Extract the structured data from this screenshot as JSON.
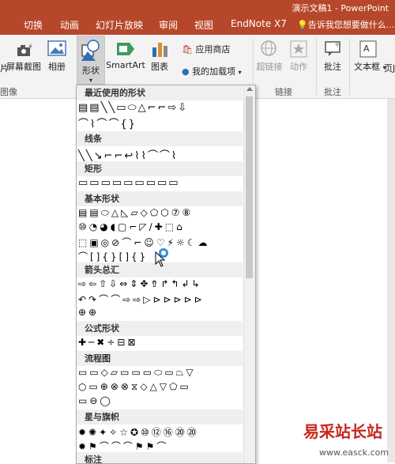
{
  "window": {
    "title": "演示文稿1 - PowerPoint"
  },
  "tabs": [
    "切换",
    "动画",
    "幻灯片放映",
    "审阅",
    "视图",
    "EndNote X7"
  ],
  "tell_me": "告诉我您想要做什么...",
  "ribbon": {
    "left_partial": "片",
    "screenshot": "屏幕截图",
    "album": "相册",
    "shapes": "形状",
    "smartart": "SmartArt",
    "chart": "图表",
    "app_store": "应用商店",
    "my_addins": "我的加载项",
    "hyperlink": "超链接",
    "action": "动作",
    "comment": "批注",
    "textbox": "文本框",
    "header_partial": "页J",
    "group_images": "图像",
    "group_links": "链接",
    "group_comments": "批注"
  },
  "shapes_panel": {
    "categories": {
      "recent": "最近使用的形状",
      "lines": "线条",
      "rect": "矩形",
      "basic": "基本形状",
      "arrows": "箭头总汇",
      "equation": "公式形状",
      "flowchart": "流程图",
      "stars": "星与旗帜",
      "callouts": "标注"
    },
    "rows": {
      "recent1": "▤▤╲╲▭⬭△⌐⌐⇨⇩",
      "recent2": "⌒⌇⌒⌒{}",
      "lines1": "╲╲↘⌐⌐↩⌇⌇⌒⌒⌇",
      "rect1": "▭▭▭▭▭▭▭▭▭",
      "basic1": "▤▤⬭△◺▱◇⬠⬡⑦⑧",
      "basic2": "⑩◔◕◖▢⌐◸∕✚⬚⌂",
      "basic3": "⬚▣◎⊘⌒⌐☺♡⚡☼☾☁",
      "basic4": "⌒[]{}[]{}",
      "arrows1": "⇨⇦⇧⇩⇔⇕✥⇮↱↰↲↳",
      "arrows2": "↶↷⌒⌒⇨⇨▷⊳⊳⊳⊳⊳",
      "arrows3": "⊕⊕",
      "equation1": "✚─✖÷⊟⊠",
      "flow1": "▭▭◇▱▭▭▭⬭▭⏢▽",
      "flow2": "○▭⊕⊗⊗⧖◇△▽⬠▭",
      "flow3": "▭⊖◯",
      "stars1": "✹✺✦✧☆✪⑩⑫⑯⑳⑳",
      "stars2": "✹⚑⌒⌒⌒⚑⚑⌒"
    }
  },
  "watermark": {
    "cn": "易采站长站",
    "url": "www.easck.com"
  }
}
